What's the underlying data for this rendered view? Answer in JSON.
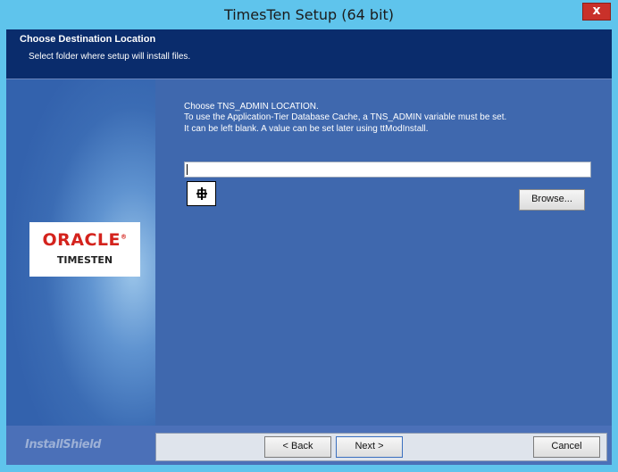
{
  "window": {
    "title": "TimesTen Setup (64 bit)",
    "close_glyph": "x"
  },
  "header": {
    "title": "Choose Destination Location",
    "subtitle": "Select folder where setup will install files."
  },
  "logo": {
    "brand": "ORACLE",
    "registered": "®",
    "product": "TIMESTEN"
  },
  "main": {
    "line1": "Choose TNS_ADMIN LOCATION.",
    "line2": "To use the Application-Tier Database Cache, a TNS_ADMIN variable must be set.",
    "line3": "It can be left blank. A value can be set later using ttModInstall.",
    "path_value": "",
    "cursor_icon": "move-cursor-icon",
    "browse_label": "Browse..."
  },
  "footer": {
    "installshield": "InstallShield",
    "back_label": "< Back",
    "next_label": "Next >",
    "cancel_label": "Cancel"
  },
  "colors": {
    "titlebar": "#5fc4ec",
    "header_bg": "#0a2c6c",
    "panel_bg": "#3f68ae",
    "close_red": "#c9312a",
    "oracle_red": "#d4231d"
  }
}
